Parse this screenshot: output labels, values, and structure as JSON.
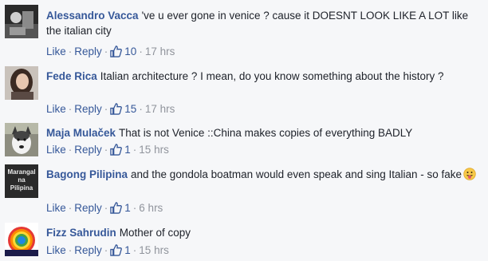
{
  "comments": [
    {
      "author": "Alessandro Vacca",
      "text": "'ve u ever gone in venice ? cause it DOESNT LOOK LIKE A LOT like the italian city",
      "like_label": "Like",
      "reply_label": "Reply",
      "likes": "10",
      "time": "17 hrs",
      "avatar_icon": "bw-photo-avatar-icon"
    },
    {
      "author": "Fede Rica",
      "text": "Italian architecture ? I mean, do you know something about the history ?",
      "like_label": "Like",
      "reply_label": "Reply",
      "likes": "15",
      "time": "17 hrs",
      "avatar_icon": "woman-photo-avatar-icon"
    },
    {
      "author": "Maja Mulaček",
      "text": "That is not Venice ::China makes copies of everything BADLY",
      "like_label": "Like",
      "reply_label": "Reply",
      "likes": "1",
      "time": "15 hrs",
      "avatar_icon": "dog-photo-avatar-icon"
    },
    {
      "author": "Bagong Pilipina",
      "text": "and the gondola boatman would even speak and sing Italian - so fake",
      "like_label": "Like",
      "reply_label": "Reply",
      "likes": "1",
      "time": "6 hrs",
      "avatar_icon": "text-logo-avatar-icon",
      "avatar_text": [
        "Marangal",
        "na",
        "Pilipina"
      ]
    },
    {
      "author": "Fizz Sahrudin",
      "text": "Mother of copy",
      "like_label": "Like",
      "reply_label": "Reply",
      "likes": "1",
      "time": "15 hrs",
      "avatar_icon": "rainbow-logo-avatar-icon"
    }
  ],
  "colors": {
    "link": "#365899",
    "meta": "#90949c",
    "text": "#1d2129",
    "background": "#f6f7f9"
  }
}
